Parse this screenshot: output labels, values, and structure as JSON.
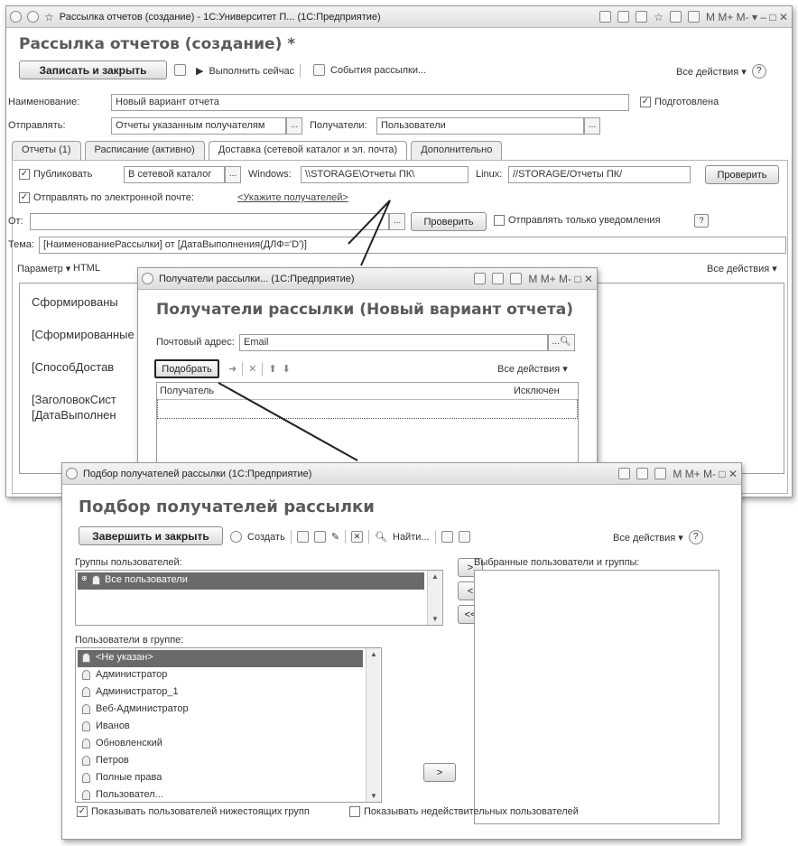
{
  "w1": {
    "title": "Рассылка отчетов (создание) - 1С:Университет П... (1С:Предприятие)",
    "tbar_right": "M M+ M- ▾  –  □  ✕",
    "heading": "Рассылка отчетов (создание) *",
    "save_close": "Записать и закрыть",
    "run_now": "Выполнить сейчас",
    "events": "События рассылки...",
    "all_actions": "Все действия ▾",
    "name_label": "Наименование:",
    "name_value": "Новый вариант отчета",
    "prepared": "Подготовлена",
    "send_label": "Отправлять:",
    "send_value": "Отчеты указанным получателям",
    "recipients_label": "Получатели:",
    "recipients_value": "Пользователи",
    "tabs": [
      "Отчеты (1)",
      "Расписание (активно)",
      "Доставка (сетевой каталог и эл. почта)",
      "Дополнительно"
    ],
    "publish": "Публиковать",
    "publish_value": "В сетевой каталог",
    "windows_label": "Windows:",
    "windows_value": "\\\\STORAGE\\Отчеты ПК\\",
    "linux_label": "Linux:",
    "linux_value": "//STORAGE/Отчеты ПК/",
    "check": "Проверить",
    "email_send": "Отправлять по электронной почте:",
    "email_link": "<Укажите получателей>",
    "from_label": "От:",
    "check2": "Проверить",
    "notify_only": "Отправлять только уведомления",
    "help": "?",
    "subject_label": "Тема:",
    "subject_value": "[НаименованиеРассылки] от [ДатаВыполнения(ДЛФ='D')]",
    "param": "Параметр ▾",
    "html": "HTML",
    "all_actions2": "Все действия ▾",
    "body_lines": [
      "Сформированы",
      "[Сформированные",
      "[СпособДостав",
      "[ЗаголовокСист",
      "[ДатаВыполнен"
    ]
  },
  "w2": {
    "title": "Получатели рассылки... (1С:Предприятие)",
    "tbar_right": "M M+ M- □ ✕",
    "heading": "Получатели рассылки (Новый вариант отчета)",
    "email_label": "Почтовый адрес:",
    "email_value": "Email",
    "pick": "Подобрать",
    "all_actions": "Все действия ▾",
    "col_recipient": "Получатель",
    "col_excluded": "Исключен"
  },
  "w3": {
    "title": "Подбор получателей рассылки (1С:Предприятие)",
    "tbar_right": "M M+ M- □ ✕",
    "heading": "Подбор получателей рассылки",
    "finish": "Завершить и закрыть",
    "create": "Создать",
    "find": "Найти...",
    "all_actions": "Все действия ▾",
    "groups_label": "Группы пользователей:",
    "groups": [
      "Все пользователи"
    ],
    "selected_label": "Выбранные пользователи и группы:",
    "users_label": "Пользователи в группе:",
    "users": [
      "<Не указан>",
      "Администратор",
      "Администратор_1",
      "Веб-Администратор",
      "Иванов",
      "Обновленский",
      "Петров",
      "Полные права",
      "Пользовател..."
    ],
    "btn_add": ">",
    "btn_remove": "<",
    "btn_remove_all": "<<",
    "btn_add2": ">",
    "show_sub": "Показывать пользователей нижестоящих групп",
    "show_invalid": "Показывать недействительных пользователей"
  }
}
